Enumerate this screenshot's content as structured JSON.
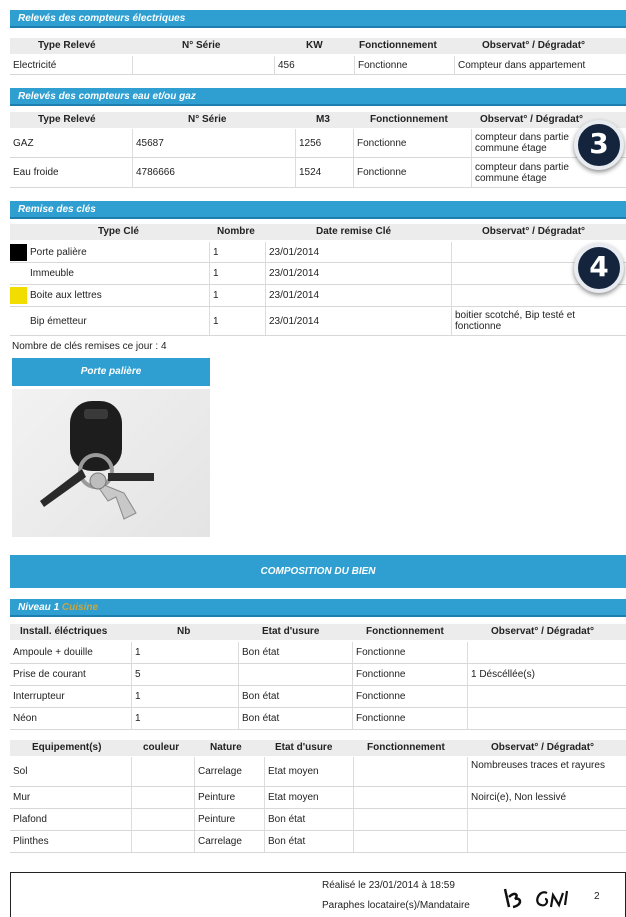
{
  "elec": {
    "title": "Relevés des compteurs électriques",
    "headers": [
      "Type Relevé",
      "N° Série",
      "KW",
      "Fonctionnement",
      "Observat° / Dégradat°"
    ],
    "rows": [
      [
        "Electricité",
        "",
        "456",
        "Fonctionne",
        "Compteur dans appartement"
      ]
    ]
  },
  "gaz": {
    "title": "Relevés des compteurs eau et/ou gaz",
    "headers": [
      "Type Relevé",
      "N° Série",
      "M3",
      "Fonctionnement",
      "Observat° / Dégradat°"
    ],
    "rows": [
      [
        "GAZ",
        "45687",
        "1256",
        "Fonctionne",
        "compteur dans partie commune étage"
      ],
      [
        "Eau froide",
        "4786666",
        "1524",
        "Fonctionne",
        "compteur dans partie commune étage"
      ]
    ]
  },
  "cles": {
    "title": "Remise des clés",
    "headers": [
      "Type Clé",
      "Nombre",
      "Date remise Clé",
      "Observat° / Dégradat°"
    ],
    "rows": [
      [
        "Porte palière",
        "1",
        "23/01/2014",
        ""
      ],
      [
        "Immeuble",
        "1",
        "23/01/2014",
        ""
      ],
      [
        "Boite aux lettres",
        "1",
        "23/01/2014",
        ""
      ],
      [
        "Bip émetteur",
        "1",
        "23/01/2014",
        "boitier scotché, Bip testé et fonctionne"
      ]
    ],
    "colors": [
      "#000000",
      "#ffffff",
      "#f2dd00",
      "#ffffff"
    ],
    "count_text": "Nombre de clés remises ce jour : 4",
    "photo_title": "Porte palière"
  },
  "badges": [
    "3",
    "4"
  ],
  "composition": {
    "title": "COMPOSITION DU BIEN",
    "niveau": "Niveau 1",
    "piece": "Cuisine"
  },
  "install": {
    "headers": [
      "Install. éléctriques",
      "Nb",
      "Etat d'usure",
      "Fonctionnement",
      "Observat° / Dégradat°"
    ],
    "rows": [
      [
        "Ampoule + douille",
        "1",
        "Bon état",
        "Fonctionne",
        ""
      ],
      [
        "Prise de courant",
        "5",
        "",
        "Fonctionne",
        "1 Déscéllée(s)"
      ],
      [
        "Interrupteur",
        "1",
        "Bon état",
        "Fonctionne",
        ""
      ],
      [
        "Néon",
        "1",
        "Bon état",
        "Fonctionne",
        ""
      ]
    ]
  },
  "equip": {
    "headers": [
      "Equipement(s)",
      "couleur",
      "Nature",
      "Etat d'usure",
      "Fonctionnement",
      "Observat° / Dégradat°"
    ],
    "rows": [
      [
        "Sol",
        "",
        "Carrelage",
        "Etat moyen",
        "",
        "Nombreuses traces et rayures"
      ],
      [
        "Mur",
        "",
        "Peinture",
        "Etat moyen",
        "",
        "Noirci(e), Non lessivé"
      ],
      [
        "Plafond",
        "",
        "Peinture",
        "Bon état",
        "",
        ""
      ],
      [
        "Plinthes",
        "",
        "Carrelage",
        "Bon état",
        "",
        ""
      ]
    ]
  },
  "footer": {
    "realise": "Réalisé le 23/01/2014 à 18:59",
    "paraphes": "Paraphes locataire(s)/Mandataire",
    "page": "2"
  }
}
